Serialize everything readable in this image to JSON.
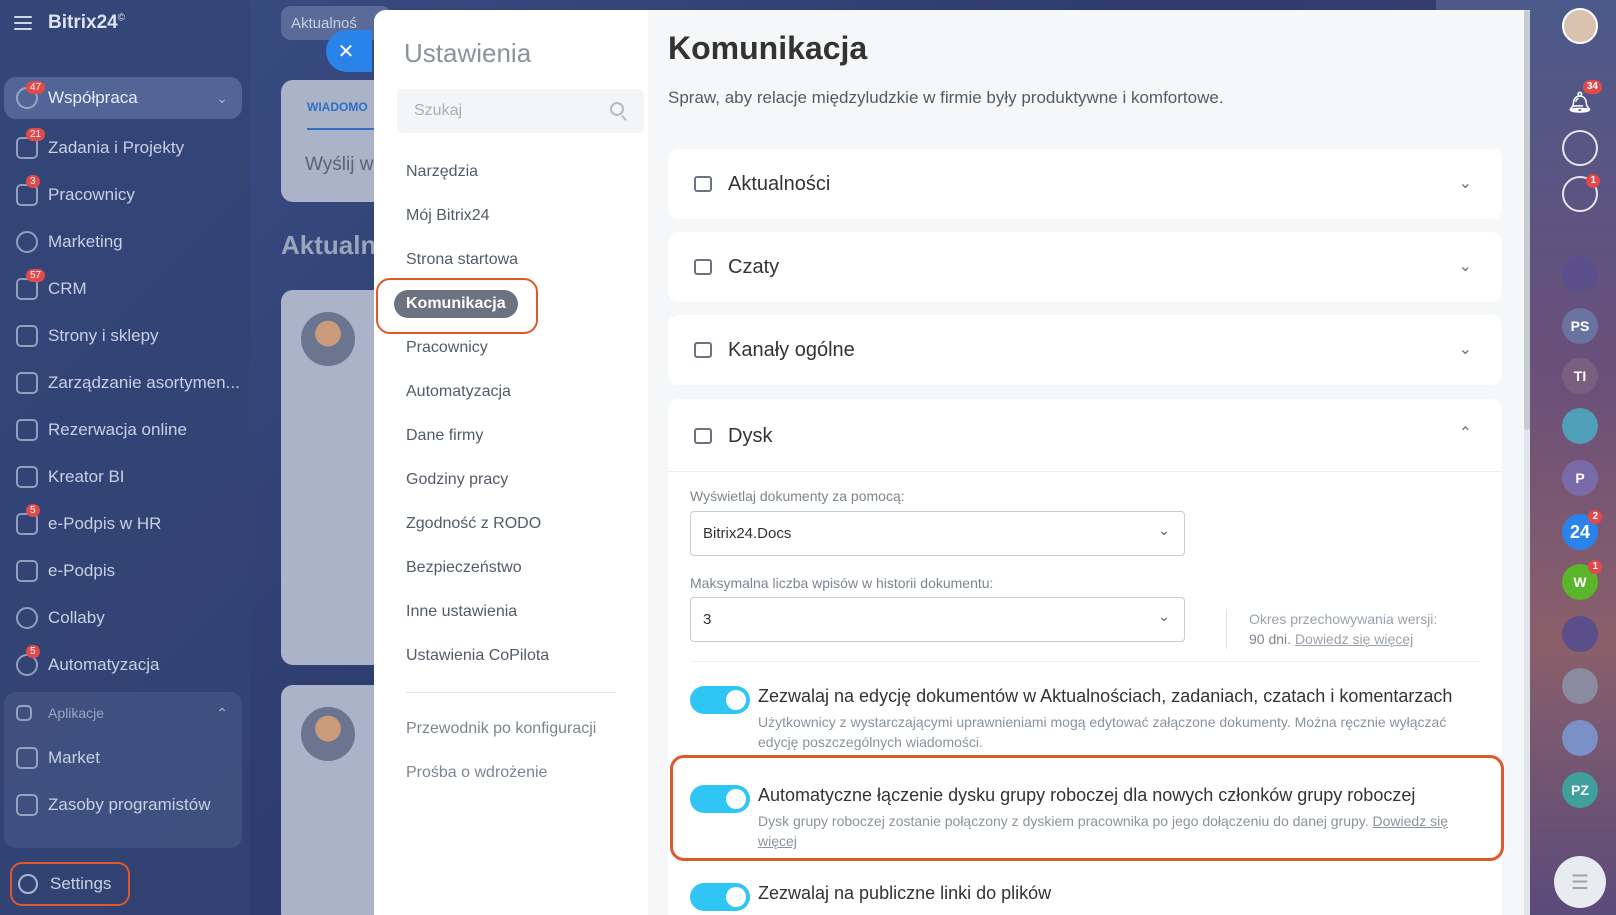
{
  "app": {
    "logo": "Bitrix24",
    "logo_sup": "©"
  },
  "left_nav": {
    "items": [
      {
        "label": "Współpraca",
        "badge": "47",
        "active": true
      },
      {
        "label": "Zadania i Projekty",
        "badge": "21"
      },
      {
        "label": "Pracownicy",
        "badge": "3"
      },
      {
        "label": "Marketing",
        "badge": ""
      },
      {
        "label": "CRM",
        "badge": "57"
      },
      {
        "label": "Strony i sklepy",
        "badge": ""
      },
      {
        "label": "Zarządzanie asortymen...",
        "badge": ""
      },
      {
        "label": "Rezerwacja online",
        "badge": ""
      },
      {
        "label": "Kreator BI",
        "badge": ""
      },
      {
        "label": "e-Podpis w HR",
        "badge": "5"
      },
      {
        "label": "e-Podpis",
        "badge": ""
      },
      {
        "label": "Collaby",
        "badge": ""
      },
      {
        "label": "Automatyzacja",
        "badge": "5"
      }
    ],
    "apps_header": "Aplikacje",
    "apps_items": [
      {
        "label": "Market"
      },
      {
        "label": "Zasoby programistów"
      }
    ],
    "settings_label": "Settings"
  },
  "background": {
    "search_text": "Aktualnoś",
    "tab_label": "WIADOMO",
    "send_text": "Wyślij w",
    "section_title": "Aktualn"
  },
  "settings_nav": {
    "title": "Ustawienia",
    "search_placeholder": "Szukaj",
    "items": [
      "Narzędzia",
      "Mój Bitrix24",
      "Strona startowa",
      "Komunikacja",
      "Pracownicy",
      "Automatyzacja",
      "Dane firmy",
      "Godziny pracy",
      "Zgodność z RODO",
      "Bezpieczeństwo",
      "Inne ustawienia",
      "Ustawienia CoPilota"
    ],
    "footer_items": [
      "Przewodnik po konfiguracji",
      "Prośba o wdrożenie"
    ]
  },
  "content": {
    "title": "Komunikacja",
    "subtitle": "Spraw, aby relacje międzyludzkie w firmie były produktywne i komfortowe.",
    "sections": [
      "Aktualności",
      "Czaty",
      "Kanały ogólne"
    ],
    "disk": {
      "title": "Dysk",
      "docs_label": "Wyświetlaj dokumenty za pomocą:",
      "docs_value": "Bitrix24.Docs",
      "history_label": "Maksymalna liczba wpisów w historii dokumentu:",
      "history_value": "3",
      "retention_label": "Okres przechowywania wersji:",
      "retention_value": "90 dni.",
      "retention_link": "Dowiedz się więcej",
      "toggles": [
        {
          "title": "Zezwalaj na edycję dokumentów w Aktualnościach, zadaniach, czatach i komentarzach",
          "desc": "Użytkownicy z wystarczającymi uprawnieniami mogą edytować załączone dokumenty. Można ręcznie wyłączać edycję poszczególnych wiadomości.",
          "link": ""
        },
        {
          "title": "Automatyczne łączenie dysku grupy roboczej dla nowych członków grupy roboczej",
          "desc": "Dysk grupy roboczej zostanie połączony z dyskiem pracownika po jego dołączeniu do danej grupy. ",
          "link": "Dowiedz się więcej"
        },
        {
          "title": "Zezwalaj na publiczne linki do plików",
          "desc": "",
          "link": ""
        }
      ]
    }
  },
  "right_rail": {
    "notifications_badge": "34",
    "chat_badge": "1",
    "bitrix_badge": "2",
    "w_badge": "1",
    "initials": [
      "PS",
      "TI",
      "P",
      "W",
      "PZ"
    ],
    "bitrix_label": "24"
  },
  "colors": {
    "accent": "#2fc6f6",
    "highlight": "#e0572a",
    "close": "#2a83e8",
    "badge": "#e2494b"
  }
}
